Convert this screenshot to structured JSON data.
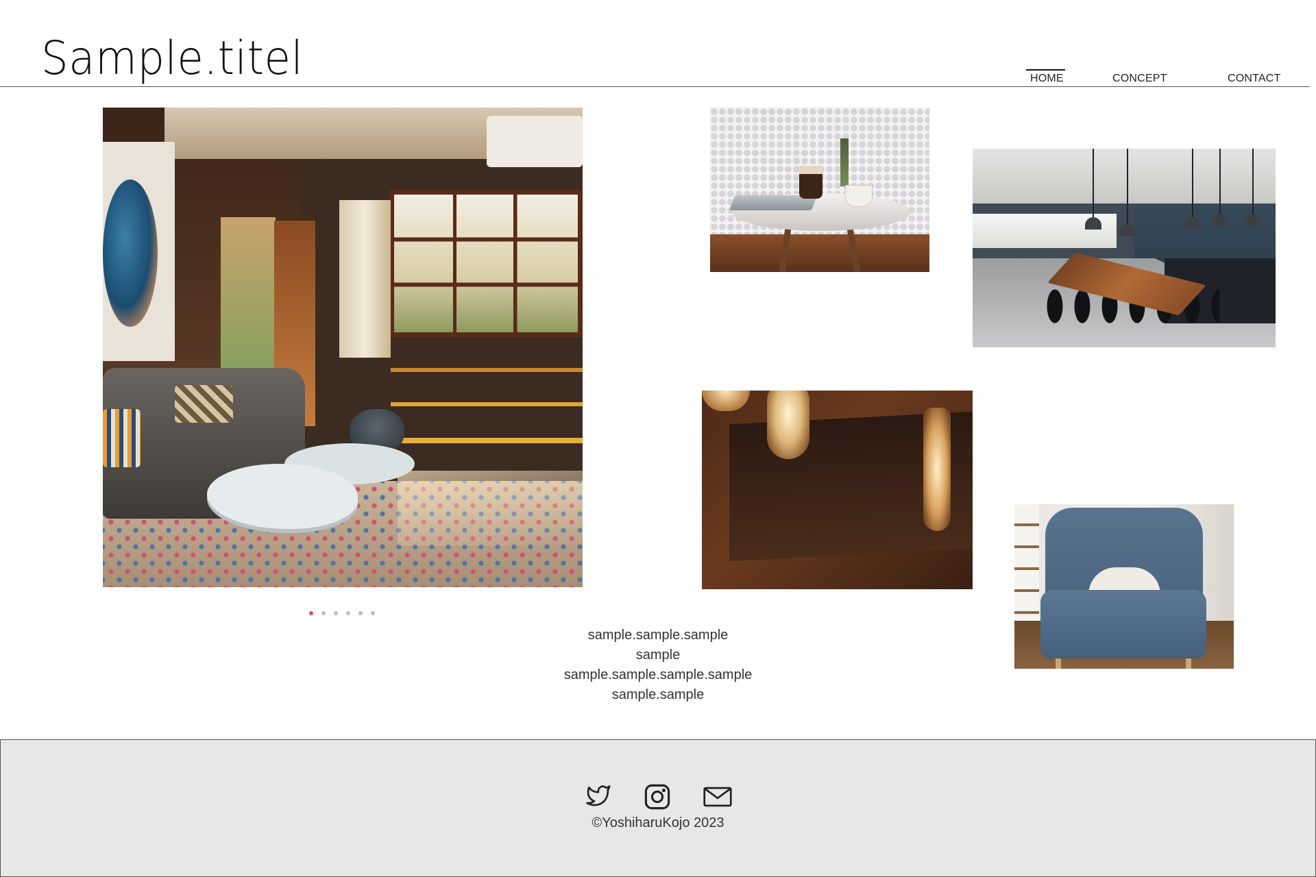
{
  "header": {
    "site_title": "Sample.titel",
    "nav": [
      {
        "label": "HOME",
        "active": true
      },
      {
        "label": "CONCEPT",
        "active": false
      },
      {
        "label": "CONTACT",
        "active": false
      }
    ]
  },
  "gallery": {
    "carousel": {
      "slide_count": 6,
      "active_index": 0
    },
    "photos": [
      {
        "subject": "living room interior"
      },
      {
        "subject": "cafe table with coffee and laptop"
      },
      {
        "subject": "dining room with wooden table"
      },
      {
        "subject": "edison light bulbs"
      },
      {
        "subject": "blue armchair"
      }
    ]
  },
  "caption": {
    "lines": [
      "sample.sample.sample",
      "sample",
      "sample.sample.sample.sample",
      "sample.sample"
    ]
  },
  "footer": {
    "social": [
      {
        "icon": "twitter-icon"
      },
      {
        "icon": "instagram-icon"
      },
      {
        "icon": "mail-icon"
      }
    ],
    "copyright": "©YoshiharuKojo 2023"
  },
  "colors": {
    "accent_dot": "#e8456b",
    "footer_bg": "#e7e7e7",
    "text": "#222222"
  }
}
